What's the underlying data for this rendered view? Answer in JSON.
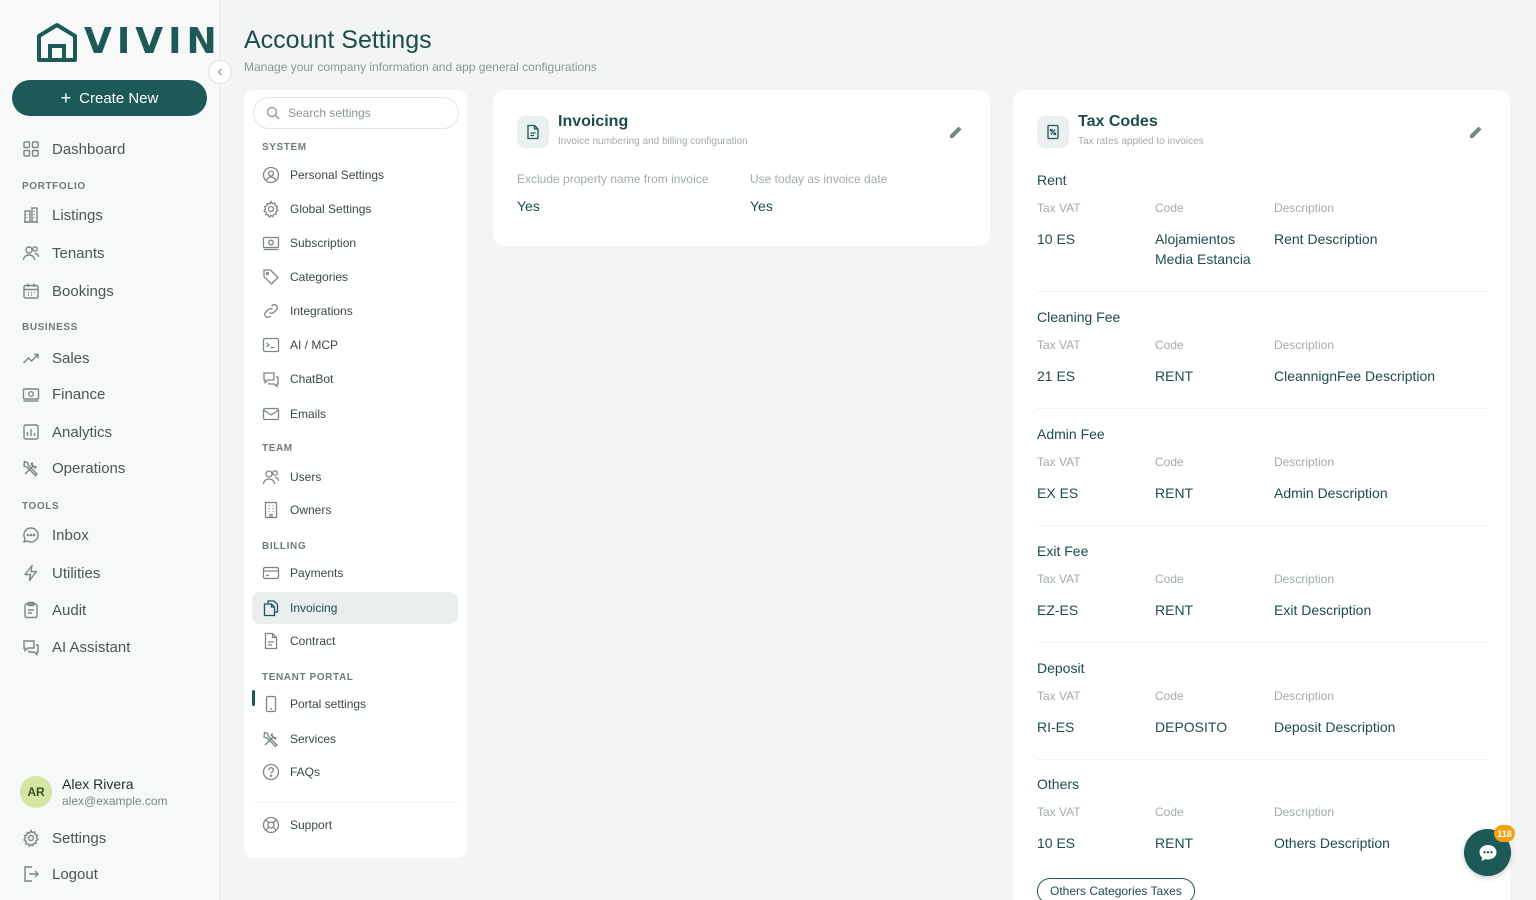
{
  "brand": {
    "name": "VIVIN",
    "color": "#1d5a57"
  },
  "sidebar": {
    "create_label": "Create New",
    "dashboard": "Dashboard",
    "sections": {
      "portfolio": "PORTFOLIO",
      "business": "BUSINESS",
      "tools": "TOOLS"
    },
    "items": {
      "listings": "Listings",
      "tenants": "Tenants",
      "bookings": "Bookings",
      "sales": "Sales",
      "finance": "Finance",
      "analytics": "Analytics",
      "operations": "Operations",
      "inbox": "Inbox",
      "utilities": "Utilities",
      "audit": "Audit",
      "ai_assistant": "AI Assistant"
    },
    "user": {
      "initials": "AR",
      "name": "Alex Rivera",
      "email": "alex@example.com"
    },
    "settings": "Settings",
    "logout": "Logout"
  },
  "header": {
    "title": "Account Settings",
    "subtitle": "Manage your company information and app general configurations"
  },
  "settings_nav": {
    "search_placeholder": "Search settings",
    "sections": {
      "system": "SYSTEM",
      "team": "TEAM",
      "billing": "BILLING",
      "tenant_portal": "TENANT PORTAL"
    },
    "items": {
      "personal": "Personal Settings",
      "global": "Global Settings",
      "subscription": "Subscription",
      "categories": "Categories",
      "integrations": "Integrations",
      "ai_mcp": "AI / MCP",
      "chatbot": "ChatBot",
      "emails": "Emails",
      "users": "Users",
      "owners": "Owners",
      "payments": "Payments",
      "invoicing": "Invoicing",
      "contract": "Contract",
      "portal_settings": "Portal settings",
      "services": "Services",
      "faqs": "FAQs",
      "support": "Support"
    },
    "active": "invoicing"
  },
  "invoicing": {
    "title": "Invoicing",
    "subtitle": "Invoice numbering and billing configuration",
    "fields": [
      {
        "label": "Exclude property name from invoice",
        "value": "Yes"
      },
      {
        "label": "Use today as invoice date",
        "value": "Yes"
      }
    ]
  },
  "tax_codes": {
    "title": "Tax Codes",
    "subtitle": "Tax rates applied to invoices",
    "columns": {
      "vat": "Tax VAT",
      "code": "Code",
      "description": "Description"
    },
    "groups": [
      {
        "name": "Rent",
        "vat": "10 ES",
        "code": "Alojamientos Media Estancia",
        "description": "Rent Description"
      },
      {
        "name": "Cleaning Fee",
        "vat": "21 ES",
        "code": "RENT",
        "description": "CleannignFee Description"
      },
      {
        "name": "Admin Fee",
        "vat": "EX ES",
        "code": "RENT",
        "description": "Admin Description"
      },
      {
        "name": "Exit Fee",
        "vat": "EZ-ES",
        "code": "RENT",
        "description": "Exit Description"
      },
      {
        "name": "Deposit",
        "vat": "RI-ES",
        "code": "DEPOSITO",
        "description": "Deposit Description"
      },
      {
        "name": "Others",
        "vat": "10 ES",
        "code": "RENT",
        "description": "Others Description"
      }
    ],
    "chip": "Others Categories Taxes"
  },
  "chat": {
    "badge": "118",
    "badge_color": "#f5a10e"
  }
}
